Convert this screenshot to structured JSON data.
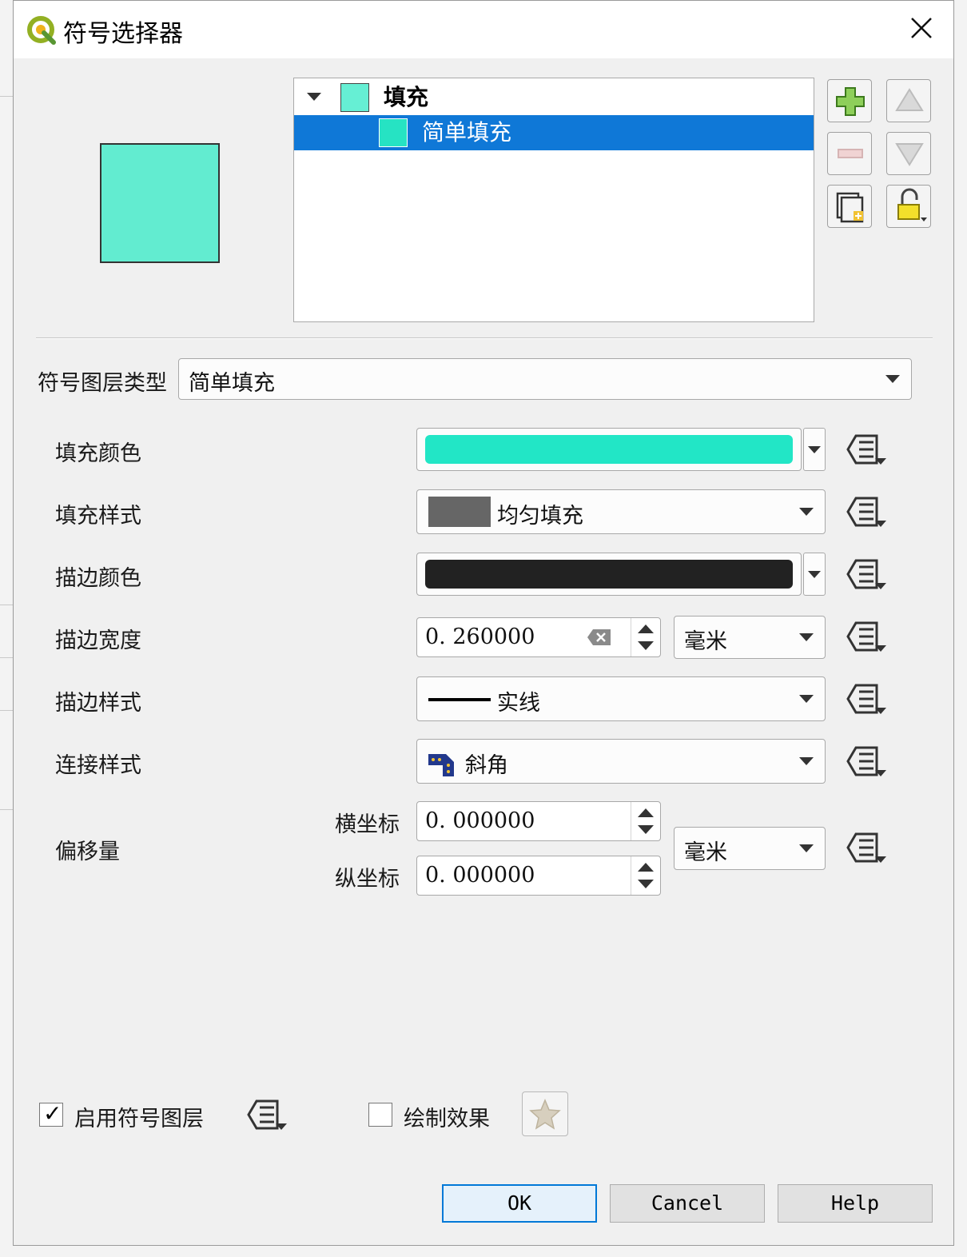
{
  "window": {
    "title": "符号选择器",
    "close_label": "×"
  },
  "layer_tree": {
    "items": [
      {
        "label": "填充",
        "swatch": "#66efd4",
        "expanded": true,
        "selected": false
      },
      {
        "label": "简单填充",
        "swatch": "#26e3c3",
        "selected": true
      }
    ]
  },
  "preview_color": "#62ecd0",
  "layer_type": {
    "label": "符号图层类型",
    "value": "简单填充"
  },
  "properties": {
    "fill_color": {
      "label": "填充颜色",
      "color": "#22e6c6"
    },
    "fill_style": {
      "label": "填充样式",
      "value": "均匀填充",
      "swatch": "#666666"
    },
    "stroke_color": {
      "label": "描边颜色",
      "color": "#222222"
    },
    "stroke_width": {
      "label": "描边宽度",
      "value": "0. 260000",
      "unit": "毫米"
    },
    "stroke_style": {
      "label": "描边样式",
      "value": "实线"
    },
    "join_style": {
      "label": "连接样式",
      "value": "斜角"
    },
    "offset": {
      "label": "偏移量",
      "x_label": "横坐标",
      "x_value": "0. 000000",
      "y_label": "纵坐标",
      "y_value": "0. 000000",
      "unit": "毫米"
    }
  },
  "footer": {
    "enable_layer": {
      "label": "启用符号图层",
      "checked": true,
      "mark": "✓"
    },
    "draw_effects": {
      "label": "绘制效果",
      "checked": false
    },
    "buttons": {
      "ok": "OK",
      "cancel": "Cancel",
      "help": "Help"
    }
  }
}
